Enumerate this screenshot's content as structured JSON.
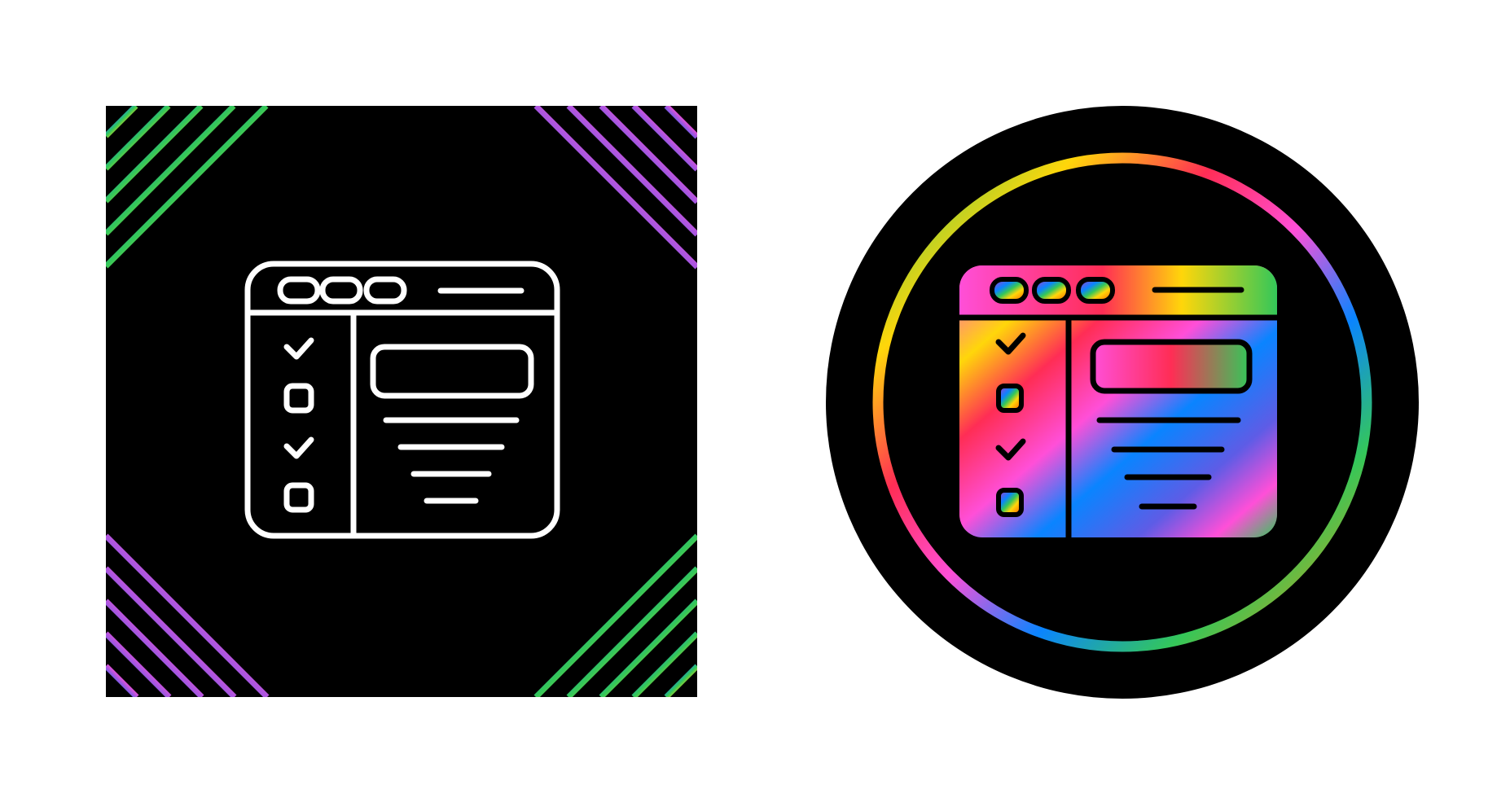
{
  "icons": [
    {
      "name": "browser-checklist-icon",
      "style": "line",
      "background": "black-square-with-rainbow-corner-stripes"
    },
    {
      "name": "browser-checklist-icon",
      "style": "gradient-filled",
      "background": "black-circle-with-rainbow-ring"
    }
  ],
  "colors": {
    "background": "#ffffff",
    "tile": "#000000",
    "line": "#ffffff",
    "rainbow": [
      "#ff2d55",
      "#ff9500",
      "#ffd60a",
      "#34c759",
      "#0a84ff",
      "#5e5ce6",
      "#ff4fd8"
    ]
  }
}
